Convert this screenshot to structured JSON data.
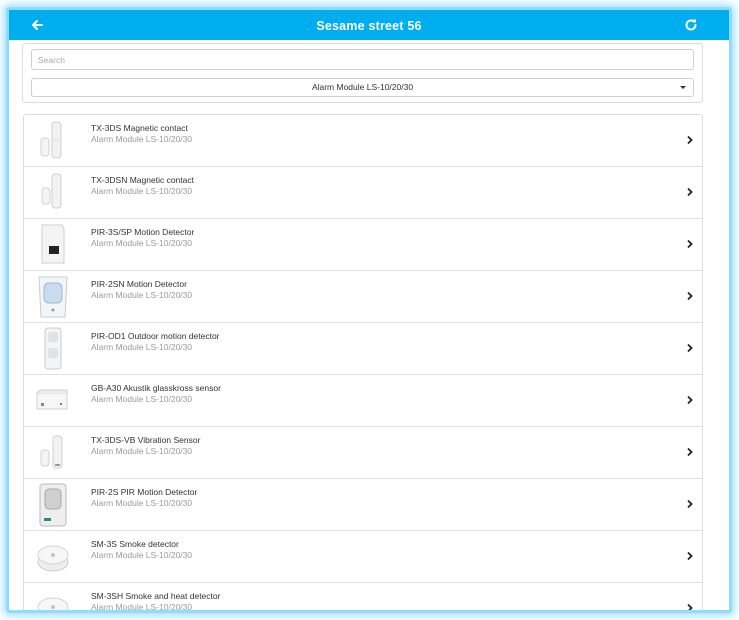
{
  "header": {
    "title": "Sesame street 56",
    "back_icon": "arrow-left-icon",
    "refresh_icon": "refresh-icon"
  },
  "filter": {
    "search_placeholder": "Search",
    "search_value": "",
    "module_selected": "Alarm Module LS-10/20/30"
  },
  "devices": [
    {
      "name": "TX-3DS Magnetic contact",
      "module": "Alarm Module LS-10/20/30",
      "icon": "magnetic-contact-icon"
    },
    {
      "name": "TX-3DSN Magnetic contact",
      "module": "Alarm Module LS-10/20/30",
      "icon": "magnetic-contact-icon"
    },
    {
      "name": "PIR-3S/SP Motion Detector",
      "module": "Alarm Module LS-10/20/30",
      "icon": "pir-detector-icon"
    },
    {
      "name": "PIR-2SN Motion Detector",
      "module": "Alarm Module LS-10/20/30",
      "icon": "pir-detector-icon"
    },
    {
      "name": "PIR-OD1 Outdoor motion detector",
      "module": "Alarm Module LS-10/20/30",
      "icon": "outdoor-detector-icon"
    },
    {
      "name": "GB-A30 Akustik glasskross sensor",
      "module": "Alarm Module LS-10/20/30",
      "icon": "glass-break-sensor-icon"
    },
    {
      "name": "TX-3DS-VB Vibration Sensor",
      "module": "Alarm Module LS-10/20/30",
      "icon": "vibration-sensor-icon"
    },
    {
      "name": "PIR-2S PIR Motion Detector",
      "module": "Alarm Module LS-10/20/30",
      "icon": "pir-detector-icon"
    },
    {
      "name": "SM-3S Smoke detector",
      "module": "Alarm Module LS-10/20/30",
      "icon": "smoke-detector-icon"
    },
    {
      "name": "SM-3SH Smoke and heat detector",
      "module": "Alarm Module LS-10/20/30",
      "icon": "smoke-detector-icon"
    }
  ]
}
